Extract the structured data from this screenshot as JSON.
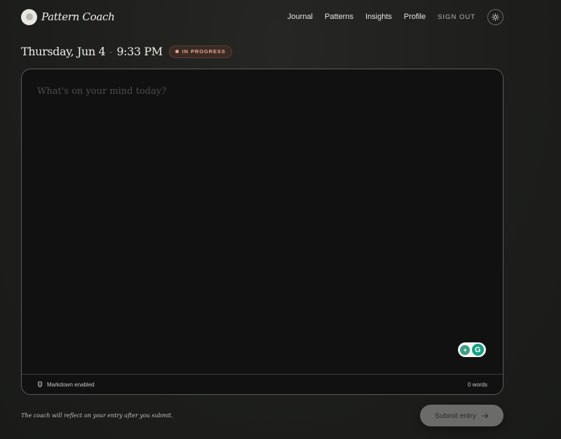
{
  "brand": {
    "name": "Pattern Coach"
  },
  "nav": {
    "items": [
      "Journal",
      "Patterns",
      "Insights",
      "Profile"
    ],
    "sign_out": "SIGN OUT",
    "theme_icon": "sun-icon"
  },
  "entry": {
    "date": "Thursday, Jun 4",
    "separator": "·",
    "time": "9:33 PM",
    "status": "IN PROGRESS"
  },
  "editor": {
    "placeholder": "What's on your mind today?",
    "value": "",
    "markdown_label": "Markdown enabled",
    "word_count": "0 words"
  },
  "footer": {
    "hint": "The coach will reflect on your entry after you submit.",
    "submit_label": "Submit entry"
  },
  "colors": {
    "background": "#1e1f1d",
    "editor_bg": "#101110",
    "badge_text": "#e9a58c",
    "submit_bg": "#6b6b69"
  }
}
